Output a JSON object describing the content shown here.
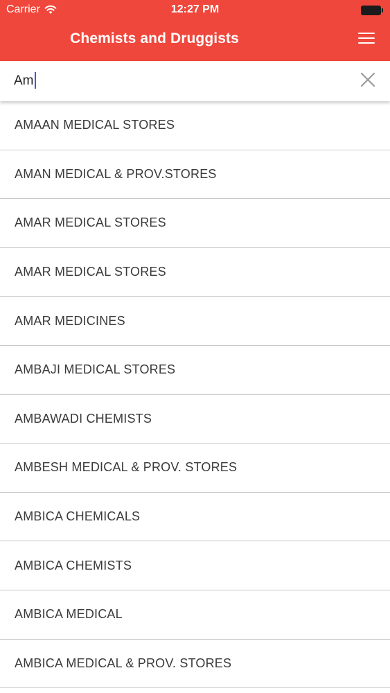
{
  "status_bar": {
    "carrier": "Carrier",
    "time": "12:27 PM"
  },
  "header": {
    "title": "Chemists and Druggists"
  },
  "search": {
    "value": "Am"
  },
  "results": [
    "AMAAN MEDICAL STORES",
    "AMAN MEDICAL & PROV.STORES",
    "AMAR MEDICAL STORES",
    "AMAR MEDICAL STORES",
    "AMAR MEDICINES",
    "AMBAJI MEDICAL STORES",
    "AMBAWADI CHEMISTS",
    "AMBESH MEDICAL & PROV. STORES",
    "AMBICA CHEMICALS",
    "AMBICA CHEMISTS",
    "AMBICA MEDICAL",
    "AMBICA MEDICAL & PROV. STORES"
  ],
  "colors": {
    "header": "#f0473c",
    "caret": "#3b5bdb"
  }
}
